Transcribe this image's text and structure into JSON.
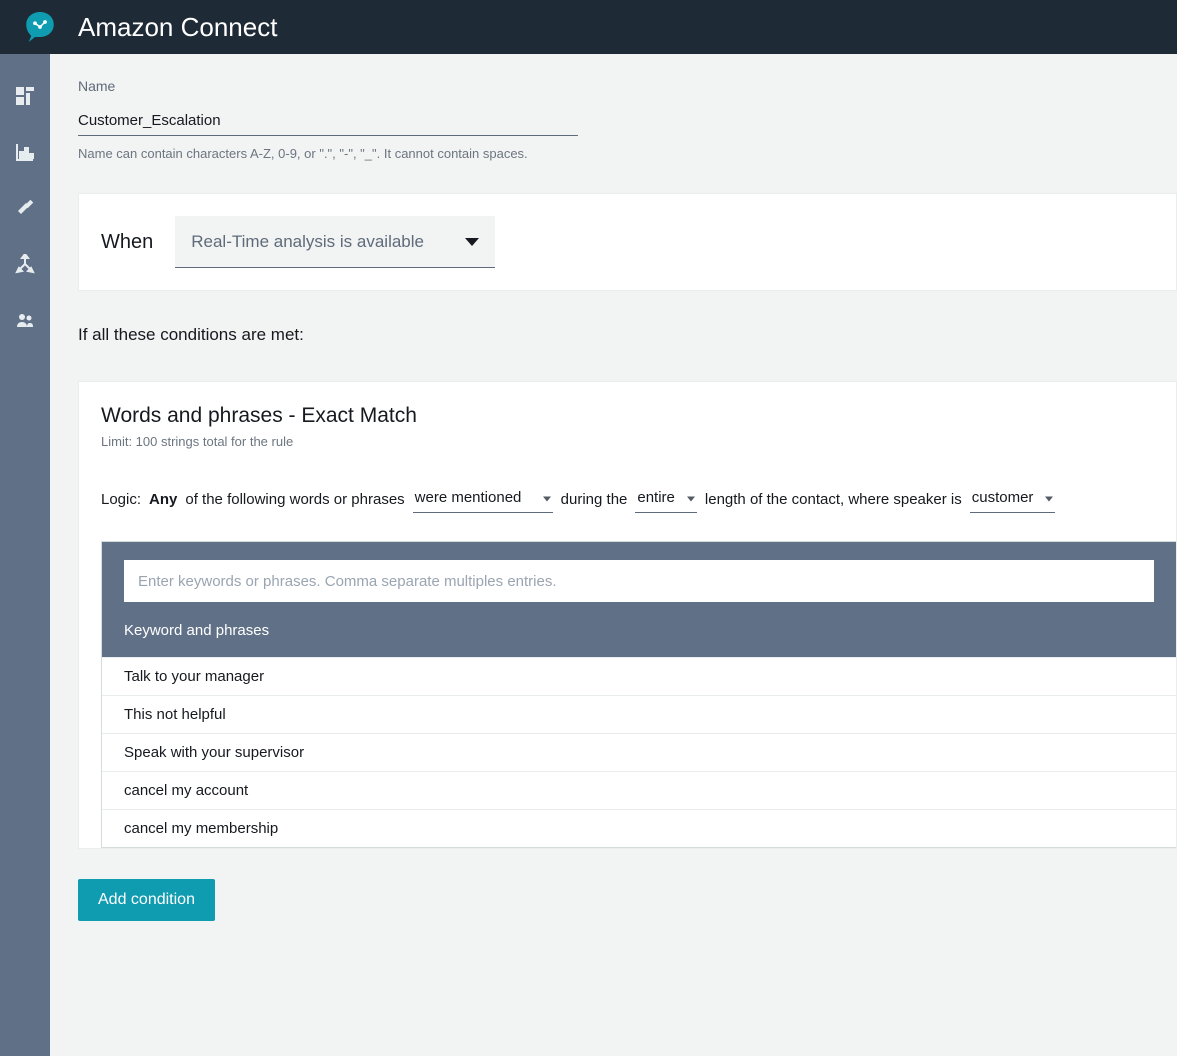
{
  "header": {
    "title": "Amazon Connect"
  },
  "sidebar": {
    "items": [
      {
        "name": "dashboard-icon"
      },
      {
        "name": "chart-icon"
      },
      {
        "name": "gavel-icon"
      },
      {
        "name": "routing-icon"
      },
      {
        "name": "people-icon"
      }
    ]
  },
  "form": {
    "name_label": "Name",
    "name_value": "Customer_Escalation",
    "name_hint": "Name can contain characters A-Z, 0-9, or \".\", \"-\", \"_\". It cannot contain spaces."
  },
  "when": {
    "label": "When",
    "selected": "Real-Time analysis is available"
  },
  "conditions_intro": "If all these conditions are met:",
  "condition": {
    "title": "Words and phrases - Exact Match",
    "subtitle": "Limit: 100 strings total for the rule",
    "logic": {
      "prefix": "Logic:",
      "any": "Any",
      "of_the_following": "of the following words or phrases",
      "mention_select": "were mentioned",
      "during": "during the",
      "span_select": "entire",
      "length_text": "length of the contact, where speaker is",
      "speaker_select": "customer"
    },
    "kw_input_placeholder": "Enter keywords or phrases. Comma separate multiples entries.",
    "kw_table_header": "Keyword and phrases",
    "keywords": [
      "Talk to your manager",
      "This not helpful",
      "Speak with your supervisor",
      "cancel my account",
      "cancel my membership"
    ]
  },
  "add_condition_label": "Add condition"
}
